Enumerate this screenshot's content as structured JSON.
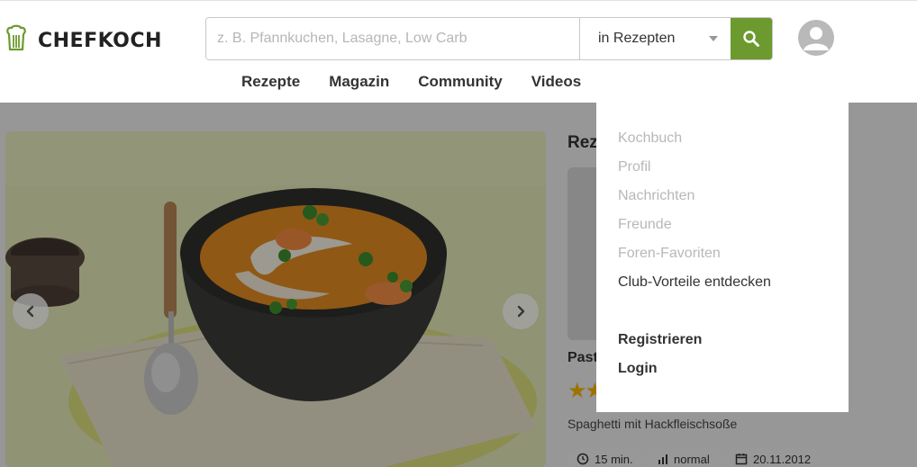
{
  "brand": {
    "name": "CHEFKOCH",
    "accent": "#6c9a2e"
  },
  "search": {
    "placeholder": "z. B. Pfannkuchen, Lasagne, Low Carb",
    "value": "",
    "scope": "in Rezepten"
  },
  "nav": {
    "items": [
      "Rezepte",
      "Magazin",
      "Community",
      "Videos"
    ]
  },
  "sidebar": {
    "title": "Rez"
  },
  "card": {
    "title": "Past",
    "stars": "★★",
    "subtitle": "Spaghetti mit Hackfleischsoße",
    "meta": {
      "time": "15 min.",
      "difficulty": "normal",
      "date": "20.11.2012"
    }
  },
  "account_menu": {
    "items": [
      {
        "label": "Kochbuch"
      },
      {
        "label": "Profil"
      },
      {
        "label": "Nachrichten"
      },
      {
        "label": "Freunde"
      },
      {
        "label": "Foren-Favoriten"
      },
      {
        "label": "Club-Vorteile entdecken"
      }
    ],
    "register": "Registrieren",
    "login": "Login"
  }
}
